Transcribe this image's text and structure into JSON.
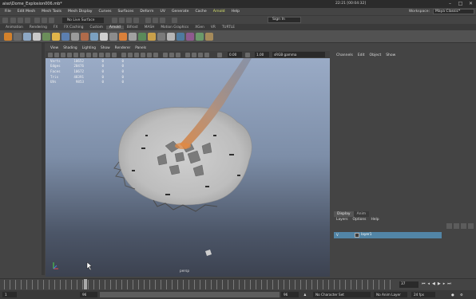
{
  "window": {
    "title": "aiso\\Dome_Explosion006.mb*",
    "right_info": "22:21 [00:04:32]"
  },
  "menubar": {
    "items": [
      "File",
      "Edit Mesh",
      "Mesh Tools",
      "Mesh Display",
      "Curves",
      "Surfaces",
      "Deform",
      "UV",
      "Generate",
      "Cache",
      "Arnold",
      "Help"
    ],
    "active_item": "Arnold",
    "workspace_label": "Workspace:",
    "workspace_value": "Maya Classic*"
  },
  "statusline": {
    "live_surface": "No Live Surface",
    "sign_in": "Sign In"
  },
  "shelf_tabs": {
    "items": [
      "Animation",
      "Rendering",
      "FX",
      "FX Caching",
      "Custom",
      "Arnold",
      "Bifrost",
      "MASH",
      "Motion Graphics",
      "XGen",
      "VR",
      "TURTLE"
    ],
    "active": "Arnold"
  },
  "viewport": {
    "menus": [
      "View",
      "Shading",
      "Lighting",
      "Show",
      "Renderer",
      "Panels"
    ],
    "near_value": "0.00",
    "far_value": "1.00",
    "colorspace": "sRGB gamma",
    "camera_label": "persp",
    "hud": [
      {
        "label": "Verts",
        "value": "10652",
        "c1": "0",
        "c2": "0"
      },
      {
        "label": "Edges",
        "value": "20476",
        "c1": "0",
        "c2": "0"
      },
      {
        "label": "Faces",
        "value": "10672",
        "c1": "0",
        "c2": "0"
      },
      {
        "label": "Tris",
        "value": "48391",
        "c1": "0",
        "c2": "0"
      },
      {
        "label": "UVs",
        "value": "9853",
        "c1": "0",
        "c2": "0"
      }
    ]
  },
  "channel_box": {
    "menus": [
      "Channels",
      "Edit",
      "Object",
      "Show"
    ]
  },
  "layer_editor": {
    "tabs": [
      "Display",
      "Anim"
    ],
    "active_tab": "Display",
    "menus": [
      "Layers",
      "Options",
      "Help"
    ],
    "layer": {
      "visible": "V",
      "name": "layer1"
    }
  },
  "timeline": {
    "current_frame": "37"
  },
  "range": {
    "start": "1",
    "end": "96",
    "anim_end": "96",
    "char_set": "No Character Set",
    "anim_layer": "No Anim Layer",
    "fps": "24 fps"
  }
}
